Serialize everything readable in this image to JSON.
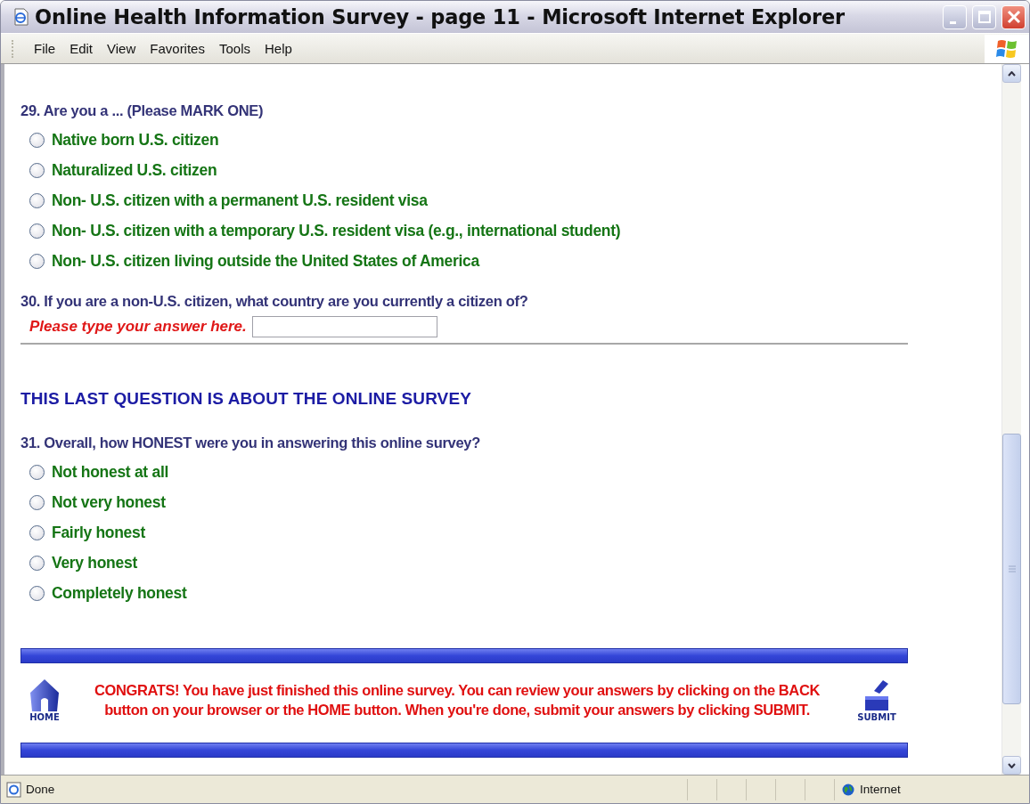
{
  "window": {
    "title": "Online Health Information Survey - page 11 - Microsoft Internet Explorer",
    "menu": [
      "File",
      "Edit",
      "View",
      "Favorites",
      "Tools",
      "Help"
    ]
  },
  "questions": [
    {
      "kind": "radio",
      "text": "29. Are you a ... (Please MARK ONE)",
      "options": [
        {
          "label": "Native born U.S. citizen",
          "selected": false
        },
        {
          "label": "Naturalized U.S. citizen",
          "selected": false
        },
        {
          "label": "Non- U.S. citizen with a permanent U.S. resident visa",
          "selected": false
        },
        {
          "label": "Non- U.S. citizen with a temporary U.S. resident visa (e.g., international student)",
          "selected": false
        },
        {
          "label": "Non- U.S. citizen living outside the United States of America",
          "selected": false
        }
      ]
    },
    {
      "kind": "text",
      "text": "30. If you are a non-U.S. citizen, what country are you currently a citizen of?",
      "prompt": "Please type your answer here."
    }
  ],
  "last_section": {
    "heading": "THIS LAST QUESTION IS ABOUT THE ONLINE SURVEY",
    "questions": [
      {
        "kind": "radio",
        "text": "31. Overall, how HONEST were you in answering this online survey?",
        "options": [
          {
            "label": "Not honest at all",
            "selected": false
          },
          {
            "label": "Not very honest",
            "selected": false
          },
          {
            "label": "Fairly honest",
            "selected": false
          },
          {
            "label": "Very honest",
            "selected": false
          },
          {
            "label": "Completely honest",
            "selected": false
          }
        ]
      }
    ]
  },
  "footer": {
    "home_label": "HOME",
    "message_lines": [
      "CONGRATS! You have just finished this online survey. You can review your answers by clicking on the BACK",
      "button on your browser or the HOME button. When you're done, submit your answers by clicking SUBMIT."
    ],
    "submit_label": "SUBMIT"
  },
  "status_bar": {
    "text": "Done",
    "zone": "Internet"
  }
}
